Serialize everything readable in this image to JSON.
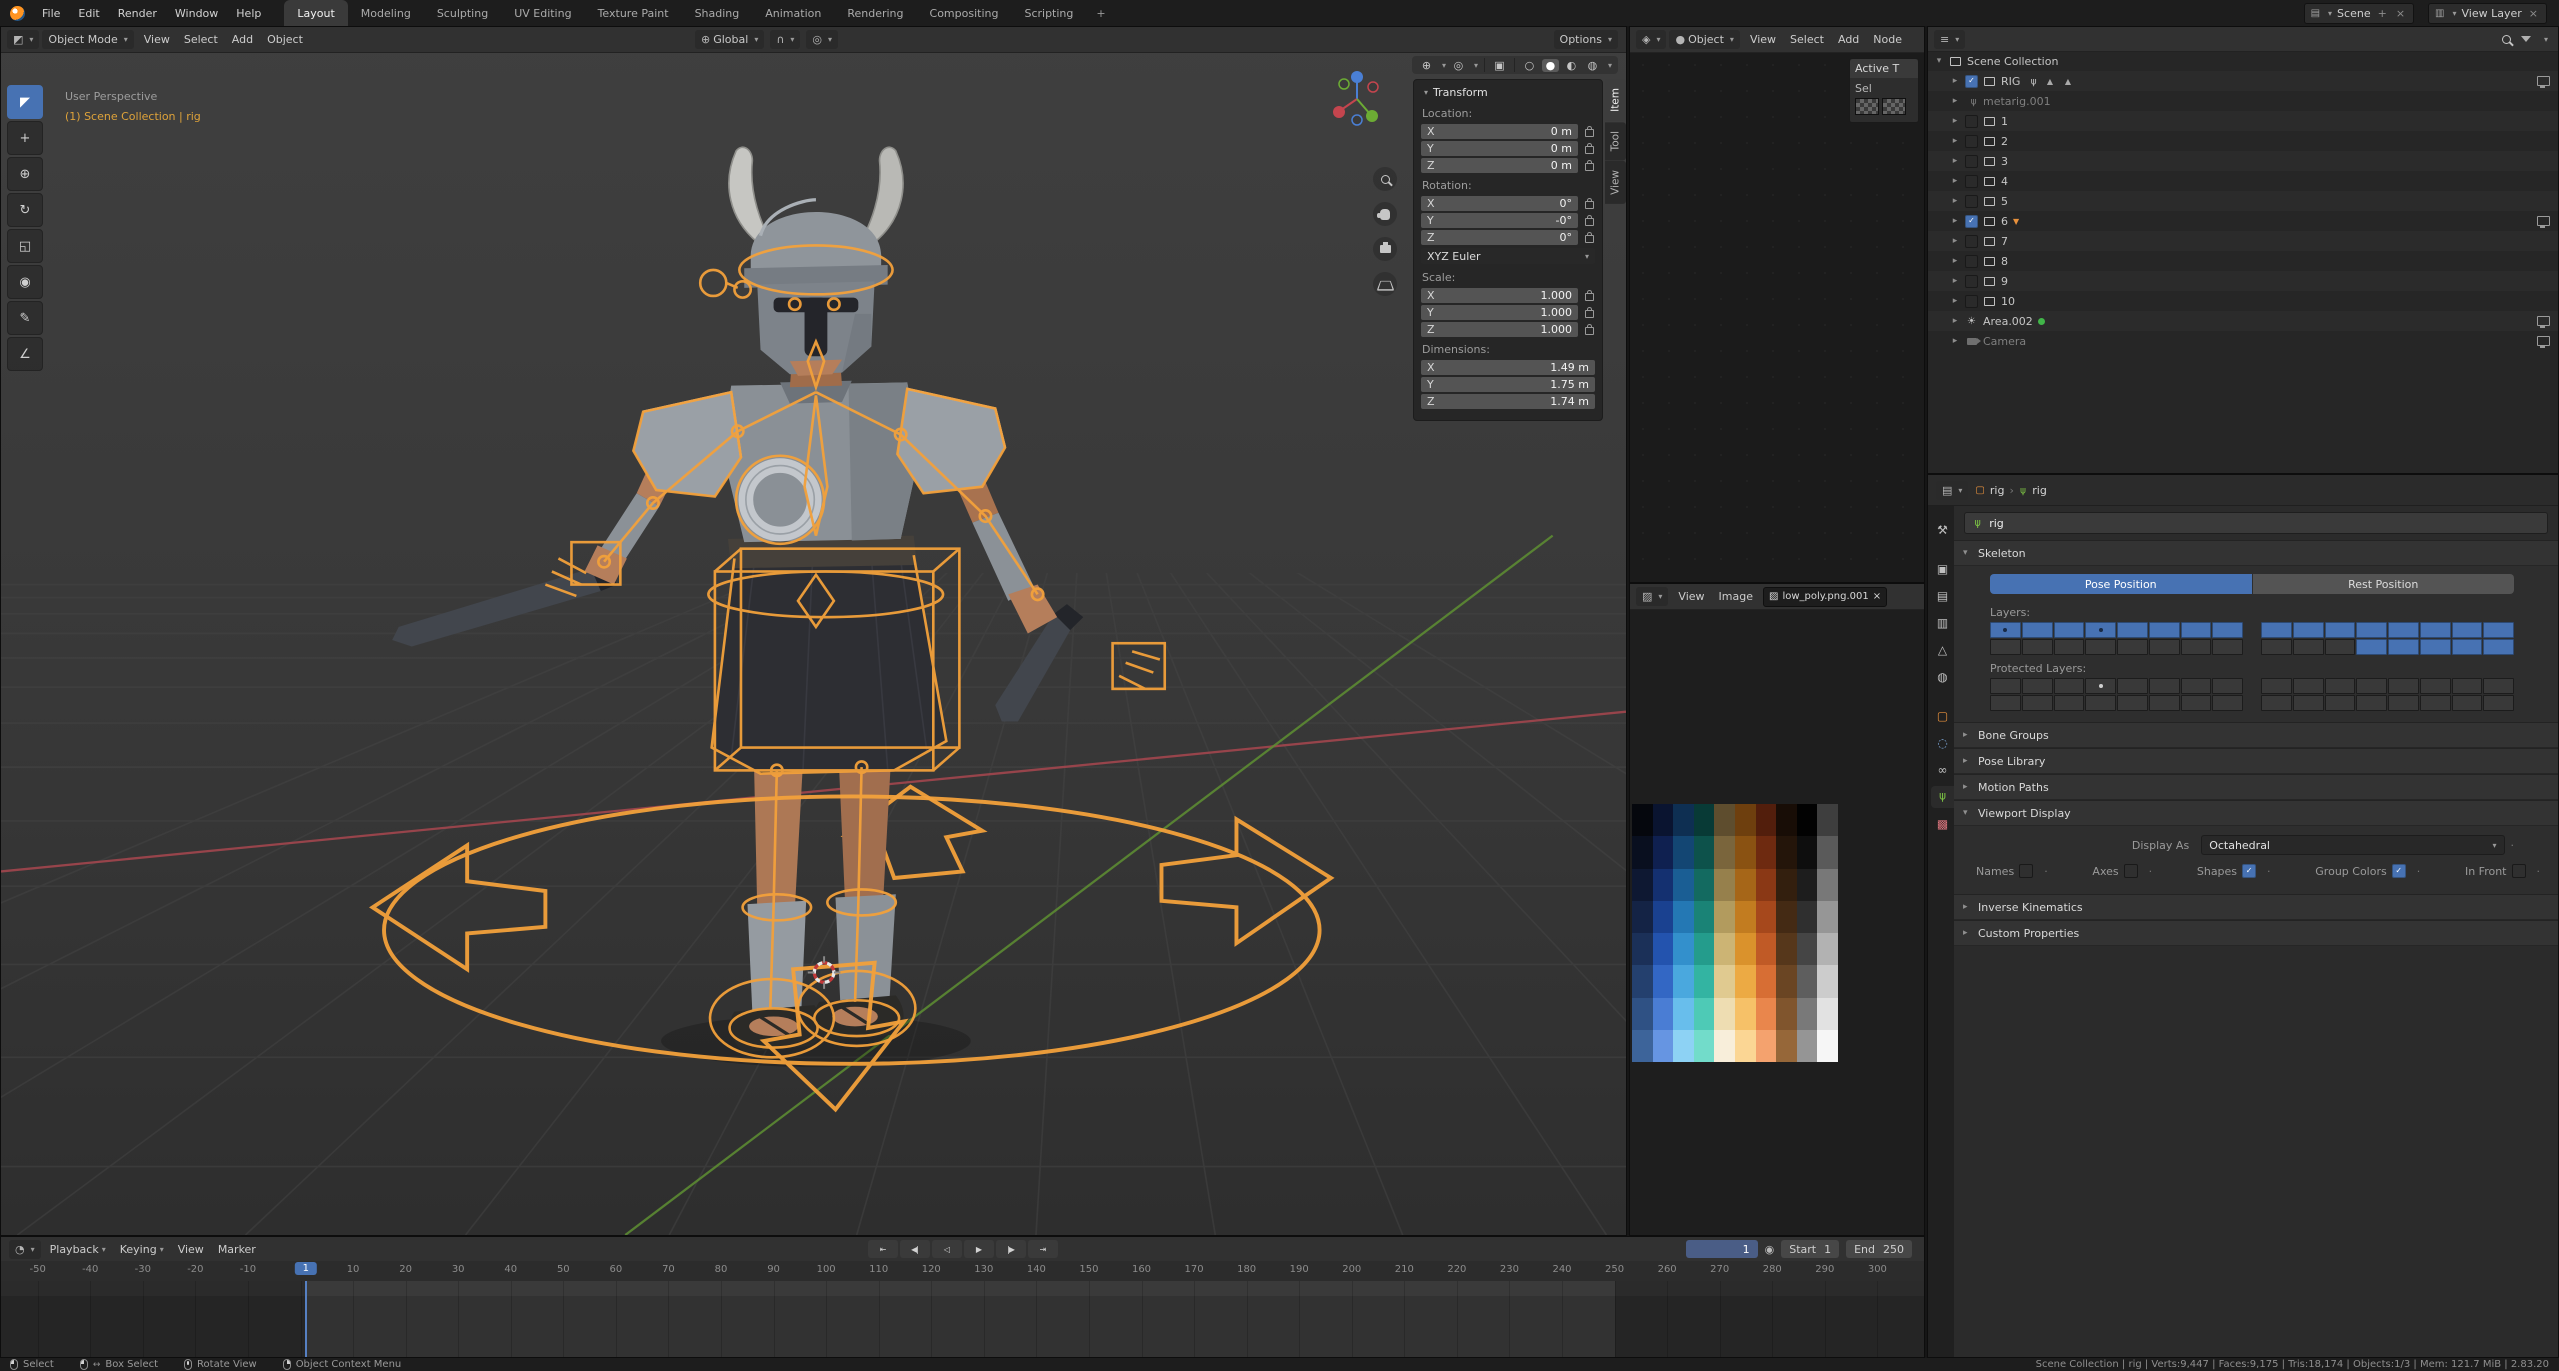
{
  "topbar": {
    "menus": [
      "File",
      "Edit",
      "Render",
      "Window",
      "Help"
    ],
    "workspaces": [
      "Layout",
      "Modeling",
      "Sculpting",
      "UV Editing",
      "Texture Paint",
      "Shading",
      "Animation",
      "Rendering",
      "Compositing",
      "Scripting"
    ],
    "active_workspace": "Layout",
    "add_workspace_label": "+",
    "scene_selector": {
      "label": "Scene"
    },
    "view_layer_selector": {
      "label": "View Layer"
    }
  },
  "viewport": {
    "header": {
      "mode": "Object Mode",
      "menus": [
        "View",
        "Select",
        "Add",
        "Object"
      ],
      "orientation": "Global",
      "options_label": "Options"
    },
    "overlay": {
      "line1": "User Perspective",
      "line2": "(1) Scene Collection | rig"
    },
    "toolbar": [
      "select-box",
      "cursor",
      "move",
      "rotate",
      "scale",
      "transform",
      "annotate",
      "measure"
    ],
    "sidebar_tabs": [
      {
        "label": "Item",
        "active": true
      },
      {
        "label": "Tool",
        "active": false
      },
      {
        "label": "View",
        "active": false
      }
    ],
    "transform_panel": {
      "title": "Transform",
      "groups": [
        {
          "label": "Location:",
          "locks": true,
          "unit_rows": [
            {
              "axis": "X",
              "value": "0 m"
            },
            {
              "axis": "Y",
              "value": "0 m"
            },
            {
              "axis": "Z",
              "value": "0 m"
            }
          ]
        },
        {
          "label": "Rotation:",
          "locks": true,
          "dropdown": "XYZ Euler",
          "unit_rows": [
            {
              "axis": "X",
              "value": "0°"
            },
            {
              "axis": "Y",
              "value": "-0°"
            },
            {
              "axis": "Z",
              "value": "0°"
            }
          ]
        },
        {
          "label": "Scale:",
          "locks": true,
          "unit_rows": [
            {
              "axis": "X",
              "value": "1.000"
            },
            {
              "axis": "Y",
              "value": "1.000"
            },
            {
              "axis": "Z",
              "value": "1.000"
            }
          ]
        },
        {
          "label": "Dimensions:",
          "locks": false,
          "unit_rows": [
            {
              "axis": "X",
              "value": "1.49 m"
            },
            {
              "axis": "Y",
              "value": "1.75 m"
            },
            {
              "axis": "Z",
              "value": "1.74 m"
            }
          ]
        }
      ]
    }
  },
  "shader_editor": {
    "mode": "Object",
    "menus": [
      "View",
      "Select",
      "Add",
      "Node"
    ],
    "side_panel": {
      "title": "Active T",
      "row": "Sel"
    }
  },
  "image_editor": {
    "menus": [
      "View",
      "Image"
    ],
    "datablock": "low_poly.png.001",
    "palette_columns": [
      [
        "#05070d",
        "#090f1f",
        "#0e1832",
        "#142345",
        "#1b3058",
        "#24406e",
        "#2f5184",
        "#3d649a"
      ],
      [
        "#0a1430",
        "#0f2050",
        "#143070",
        "#1a4190",
        "#2353ae",
        "#3367c4",
        "#4a7dd4",
        "#6695e2"
      ],
      [
        "#0e2f52",
        "#134673",
        "#1a5e94",
        "#2478b4",
        "#3390cc",
        "#4aa8de",
        "#68beec",
        "#8dd2f4"
      ],
      [
        "#083a36",
        "#0d524b",
        "#136a60",
        "#1a8376",
        "#249c8c",
        "#33b4a2",
        "#4ecab6",
        "#72dcca"
      ],
      [
        "#5e4d2e",
        "#7a653c",
        "#96804c",
        "#b29b5e",
        "#ccb474",
        "#e0ca90",
        "#eeddb2",
        "#f8eeda"
      ],
      [
        "#6e3f0e",
        "#8a5212",
        "#a66618",
        "#c27c20",
        "#da922c",
        "#ecaa44",
        "#f6c168",
        "#fbd694"
      ],
      [
        "#521e0c",
        "#6e2a10",
        "#8a3815",
        "#a6481c",
        "#c05a26",
        "#d76e34",
        "#e9864c",
        "#f4a26e"
      ],
      [
        "#180d06",
        "#24150a",
        "#331f0e",
        "#442a14",
        "#56371b",
        "#6a4523",
        "#80552d",
        "#966739"
      ],
      [
        "#020202",
        "#0e0e0e",
        "#1d1d1d",
        "#2f2f2f",
        "#454545",
        "#5e5e5e",
        "#797979",
        "#959595"
      ],
      [
        "#3e3e3e",
        "#5a5a5a",
        "#787878",
        "#969696",
        "#b2b2b2",
        "#cccccc",
        "#e2e2e2",
        "#f6f6f6"
      ]
    ]
  },
  "outliner": {
    "rows": [
      {
        "name": "Scene Collection",
        "icon": "collection",
        "level": 0,
        "expander": "open"
      },
      {
        "name": "RIG",
        "icon": "collection",
        "level": 1,
        "expander": "closed",
        "checkbox": "checked",
        "child_icons": [
          "armature",
          "mesh",
          "mesh"
        ],
        "monitor": true
      },
      {
        "name": "metarig.001",
        "icon": "armature",
        "level": 1,
        "expander": "closed",
        "dim": true
      },
      {
        "name": "1",
        "icon": "collection",
        "level": 1,
        "expander": "closed",
        "checkbox": "unchecked"
      },
      {
        "name": "2",
        "icon": "collection",
        "level": 1,
        "expander": "closed",
        "checkbox": "unchecked"
      },
      {
        "name": "3",
        "icon": "collection",
        "level": 1,
        "expander": "closed",
        "checkbox": "unchecked"
      },
      {
        "name": "4",
        "icon": "collection",
        "level": 1,
        "expander": "closed",
        "checkbox": "unchecked"
      },
      {
        "name": "5",
        "icon": "collection",
        "level": 1,
        "expander": "closed",
        "checkbox": "unchecked"
      },
      {
        "name": "6",
        "icon": "collection",
        "level": 1,
        "expander": "closed",
        "checkbox": "checked",
        "active_marker": true,
        "monitor": true
      },
      {
        "name": "7",
        "icon": "collection",
        "level": 1,
        "expander": "closed",
        "checkbox": "unchecked"
      },
      {
        "name": "8",
        "icon": "collection",
        "level": 1,
        "expander": "closed",
        "checkbox": "unchecked"
      },
      {
        "name": "9",
        "icon": "collection",
        "level": 1,
        "expander": "closed",
        "checkbox": "unchecked"
      },
      {
        "name": "10",
        "icon": "collection",
        "level": 1,
        "expander": "closed",
        "checkbox": "unchecked"
      },
      {
        "name": "Area.002",
        "icon": "light",
        "level": 1,
        "expander": "closed",
        "badge": true,
        "monitor": true
      },
      {
        "name": "Camera",
        "icon": "camera",
        "level": 1,
        "expander": "closed",
        "dim": true,
        "monitor": true
      }
    ]
  },
  "properties": {
    "breadcrumb": {
      "object": "rig",
      "data": "rig",
      "separator": "›"
    },
    "name_field": "rig",
    "tabs": [
      "tool",
      "render",
      "output",
      "view-layer",
      "scene",
      "world",
      "object",
      "physics",
      "constraints",
      "data",
      "texture"
    ],
    "active_tab": "data",
    "skeleton": {
      "title": "Skeleton",
      "pose_button": "Pose Position",
      "rest_button": "Rest Position",
      "pose_active": true,
      "layers_label": "Layers:",
      "layers_on": [
        [
          1,
          1,
          1,
          1,
          1,
          1,
          1,
          1,
          1,
          1,
          1,
          1,
          1,
          1,
          1,
          1
        ],
        [
          0,
          0,
          0,
          0,
          0,
          0,
          0,
          0,
          0,
          0,
          0,
          1,
          1,
          1,
          1,
          1
        ]
      ],
      "layers_dot": [
        [
          1,
          0,
          0,
          1,
          0,
          0,
          0,
          0,
          0,
          0,
          0,
          0,
          0,
          0,
          0,
          0
        ],
        [
          0,
          0,
          0,
          0,
          0,
          0,
          0,
          0,
          0,
          0,
          0,
          0,
          0,
          0,
          0,
          0
        ]
      ],
      "protected_label": "Protected Layers:",
      "protected_on": [
        [
          0,
          0,
          0,
          0,
          0,
          0,
          0,
          0,
          0,
          0,
          0,
          0,
          0,
          0,
          0,
          0
        ],
        [
          0,
          0,
          0,
          0,
          0,
          0,
          0,
          0,
          0,
          0,
          0,
          0,
          0,
          0,
          0,
          0
        ]
      ],
      "protected_dot": [
        [
          0,
          0,
          0,
          1,
          0,
          0,
          0,
          0,
          0,
          0,
          0,
          0,
          0,
          0,
          0,
          0
        ],
        [
          0,
          0,
          0,
          0,
          0,
          0,
          0,
          0,
          0,
          0,
          0,
          0,
          0,
          0,
          0,
          0
        ]
      ]
    },
    "collapsed_panels_top": [
      "Bone Groups",
      "Pose Library",
      "Motion Paths"
    ],
    "viewport_display": {
      "title": "Viewport Display",
      "display_as_label": "Display As",
      "display_as_value": "Octahedral",
      "options": [
        {
          "label": "Names",
          "checked": false
        },
        {
          "label": "Axes",
          "checked": false
        },
        {
          "label": "Shapes",
          "checked": true
        },
        {
          "label": "Group Colors",
          "checked": true
        },
        {
          "label": "In Front",
          "checked": false
        }
      ]
    },
    "collapsed_panels_bottom": [
      "Inverse Kinematics",
      "Custom Properties"
    ]
  },
  "timeline": {
    "menus": [
      "Playback",
      "Keying",
      "View",
      "Marker"
    ],
    "transport": [
      "jump-start",
      "prev-keyframe",
      "play-reverse",
      "play",
      "next-keyframe",
      "jump-end"
    ],
    "current_frame": "1",
    "start_label": "Start",
    "start_value": "1",
    "end_label": "End",
    "end_value": "250",
    "ruler_labels": [
      -50,
      -40,
      -30,
      -20,
      -10,
      10,
      20,
      30,
      40,
      50,
      60,
      70,
      80,
      90,
      100,
      110,
      120,
      130,
      140,
      150,
      160,
      170,
      180,
      190,
      200,
      210,
      220,
      230,
      240,
      250,
      260,
      270,
      280,
      290,
      300
    ]
  },
  "statusbar": {
    "hints": [
      {
        "label": "Select",
        "button": "left"
      },
      {
        "label": "Box Select",
        "button": "left-drag"
      },
      {
        "label": "Rotate View",
        "button": "middle"
      },
      {
        "label": "Object Context Menu",
        "button": "right"
      }
    ],
    "stats": "Scene Collection | rig | Verts:9,447 | Faces:9,175 | Tris:18,174 | Objects:1/3 | Mem: 121.7 MiB | 2.83.20"
  },
  "colors": {
    "accent": "#4772b3",
    "bone_select": "#f3a13b",
    "axis_x": "#a8474f",
    "axis_y": "#5e8f33"
  }
}
